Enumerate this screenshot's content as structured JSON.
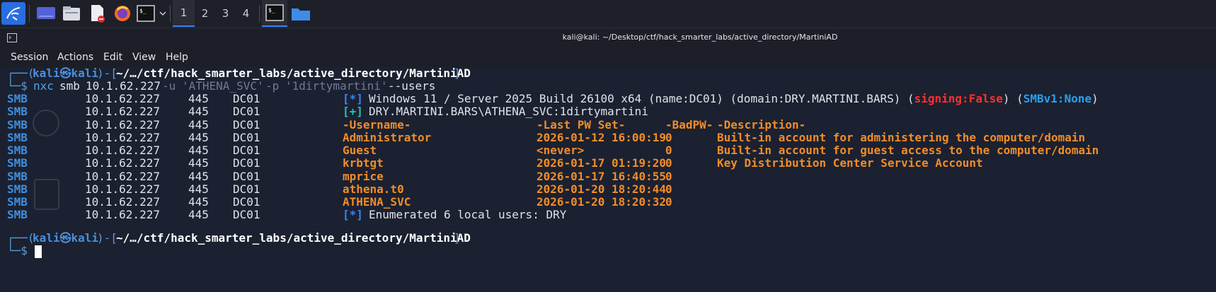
{
  "taskbar": {
    "workspaces": [
      "1",
      "2",
      "3",
      "4"
    ],
    "icons": [
      "kali-menu-icon",
      "desktop-icon",
      "file-manager-icon",
      "text-editor-icon",
      "firefox-icon",
      "terminal-icon",
      "dropdown-icon",
      "active-terminal-icon",
      "folder-icon"
    ]
  },
  "window": {
    "title": "kali@kali: ~/Desktop/ctf/hack_smarter_labs/active_directory/MartiniAD"
  },
  "menu": [
    "Session",
    "Actions",
    "Edit",
    "View",
    "Help"
  ],
  "prompt": {
    "open": "┌──(",
    "user": "kali㉿kali",
    "mid": ")-[",
    "path": "~/…/ctf/hack_smarter_labs/active_directory/MartiniAD",
    "close": "]",
    "second": "└─$"
  },
  "command": {
    "bin": "nxc",
    "proto": "smb",
    "target": "10.1.62.227",
    "u_flag": "-u",
    "u_val": "'ATHENA_SVC'",
    "p_flag": "-p",
    "p_val": "'1dirtymartini'",
    "users_flag": "--users"
  },
  "output": {
    "proto": "SMB",
    "ip": "10.1.62.227",
    "port": "445",
    "host": "DC01",
    "info_line": {
      "tag": "[*]",
      "text": "Windows 11 / Server 2025 Build 26100 x64 (name:DC01) (domain:DRY.MARTINI.BARS) (",
      "signing": "signing:False",
      "mid": ") (",
      "smbv1": "SMBv1:None",
      "end": ")"
    },
    "auth_line": {
      "tag": "[+]",
      "text": "DRY.MARTINI.BARS\\ATHENA_SVC:1dirtymartini"
    },
    "headers": {
      "username": "-Username-",
      "last_pw": "-Last PW Set-",
      "badpw": "-BadPW-",
      "desc": "-Description-"
    },
    "users": [
      {
        "name": "Administrator",
        "last_pw": "2026-01-12 16:00:19",
        "badpw": "0",
        "desc": "Built-in account for administering the computer/domain"
      },
      {
        "name": "Guest",
        "last_pw": "<never>",
        "badpw": "0",
        "desc": "Built-in account for guest access to the computer/domain"
      },
      {
        "name": "krbtgt",
        "last_pw": "2026-01-17 01:19:20",
        "badpw": "0",
        "desc": "Key Distribution Center Service Account"
      },
      {
        "name": "mprice",
        "last_pw": "2026-01-17 16:40:55",
        "badpw": "0",
        "desc": ""
      },
      {
        "name": "athena.t0",
        "last_pw": "2026-01-20 18:20:44",
        "badpw": "0",
        "desc": ""
      },
      {
        "name": "ATHENA_SVC",
        "last_pw": "2026-01-20 18:20:32",
        "badpw": "0",
        "desc": ""
      }
    ],
    "summary": {
      "tag": "[*]",
      "text": "Enumerated 6 local users: DRY"
    }
  },
  "colors": {
    "accent": "#3b82f6",
    "orange": "#f28c28",
    "red": "#ff3030",
    "terminal_bg": "#1b2130"
  }
}
